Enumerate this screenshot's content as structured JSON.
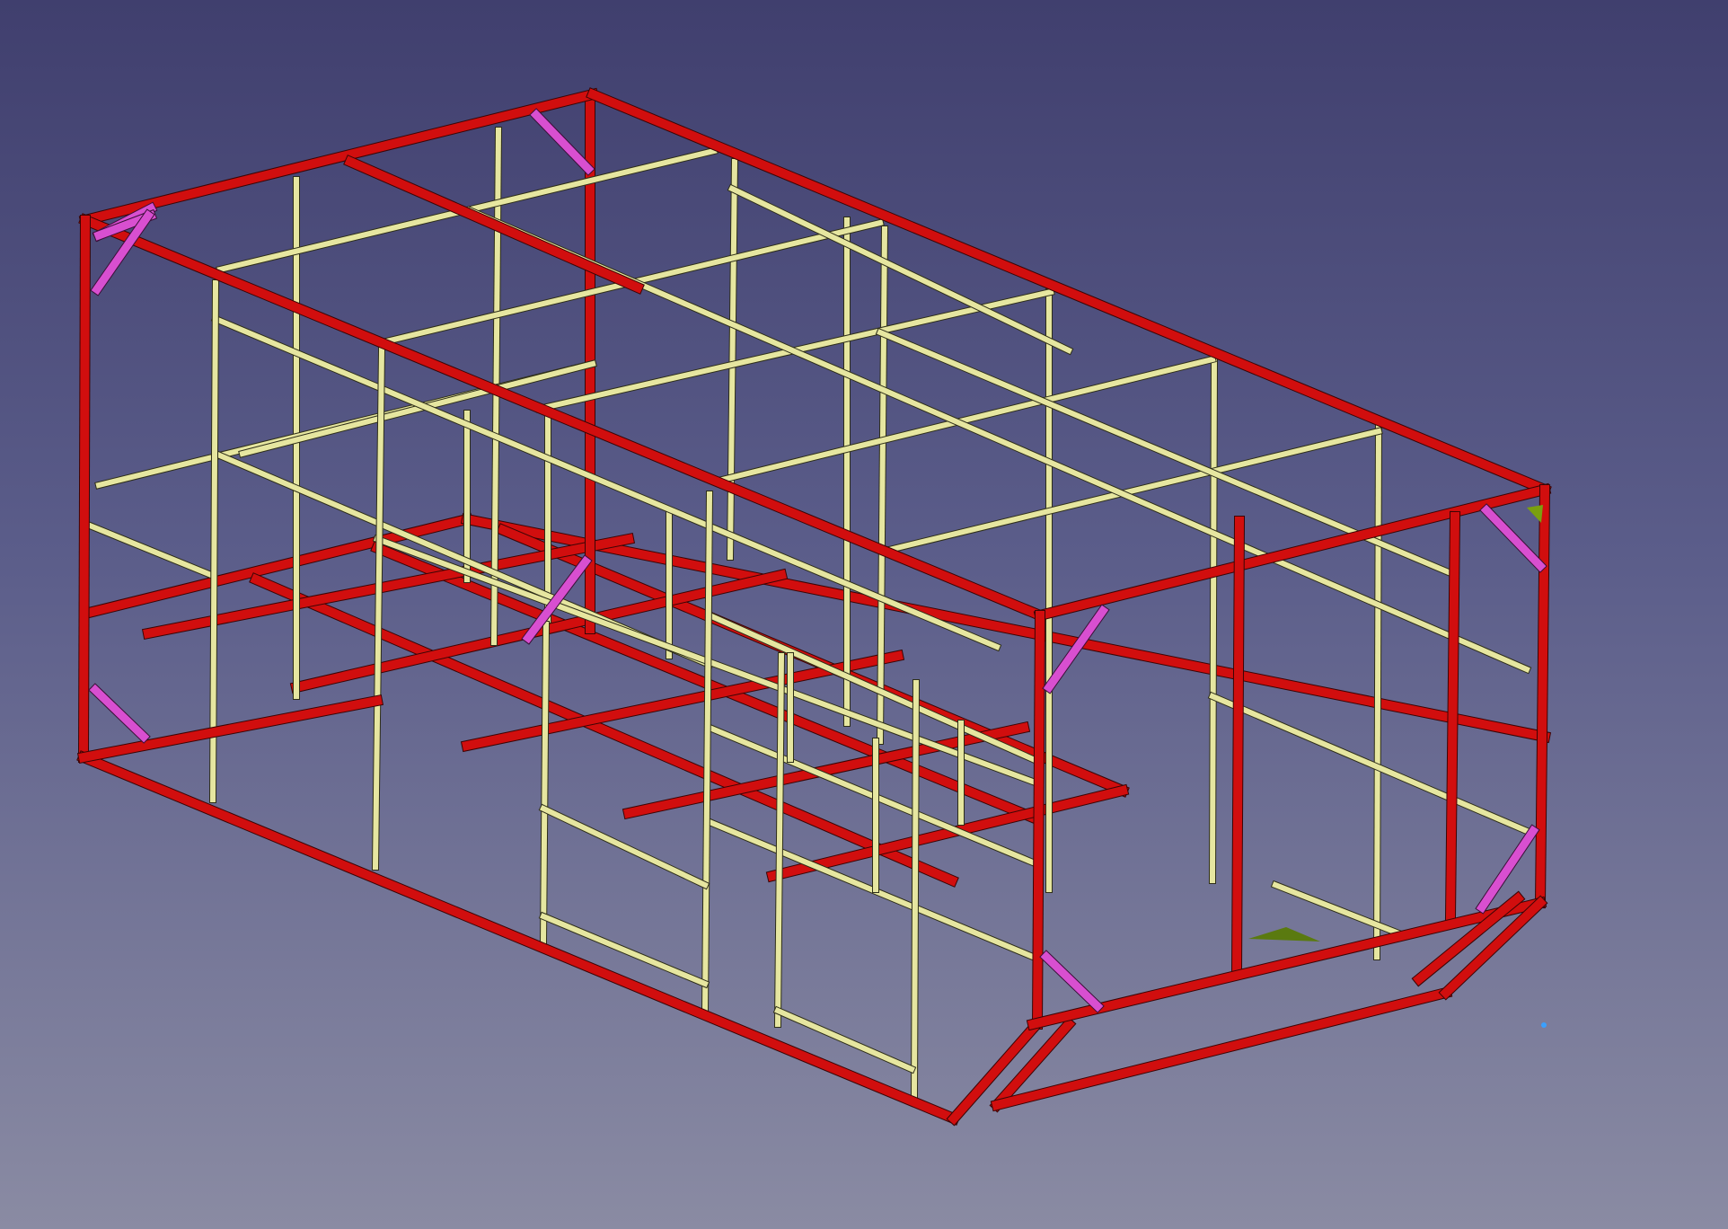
{
  "viewer": {
    "background_top": "#403f6e",
    "background_bottom": "#8a8ba3",
    "model": "frame-structure",
    "colors": {
      "main_frame": "#d10e0e",
      "studs": "#e6e6a0",
      "braces": "#d84fd0",
      "gussets": "#7aa010"
    },
    "selection_indicator_color": "#3aa0ff"
  }
}
